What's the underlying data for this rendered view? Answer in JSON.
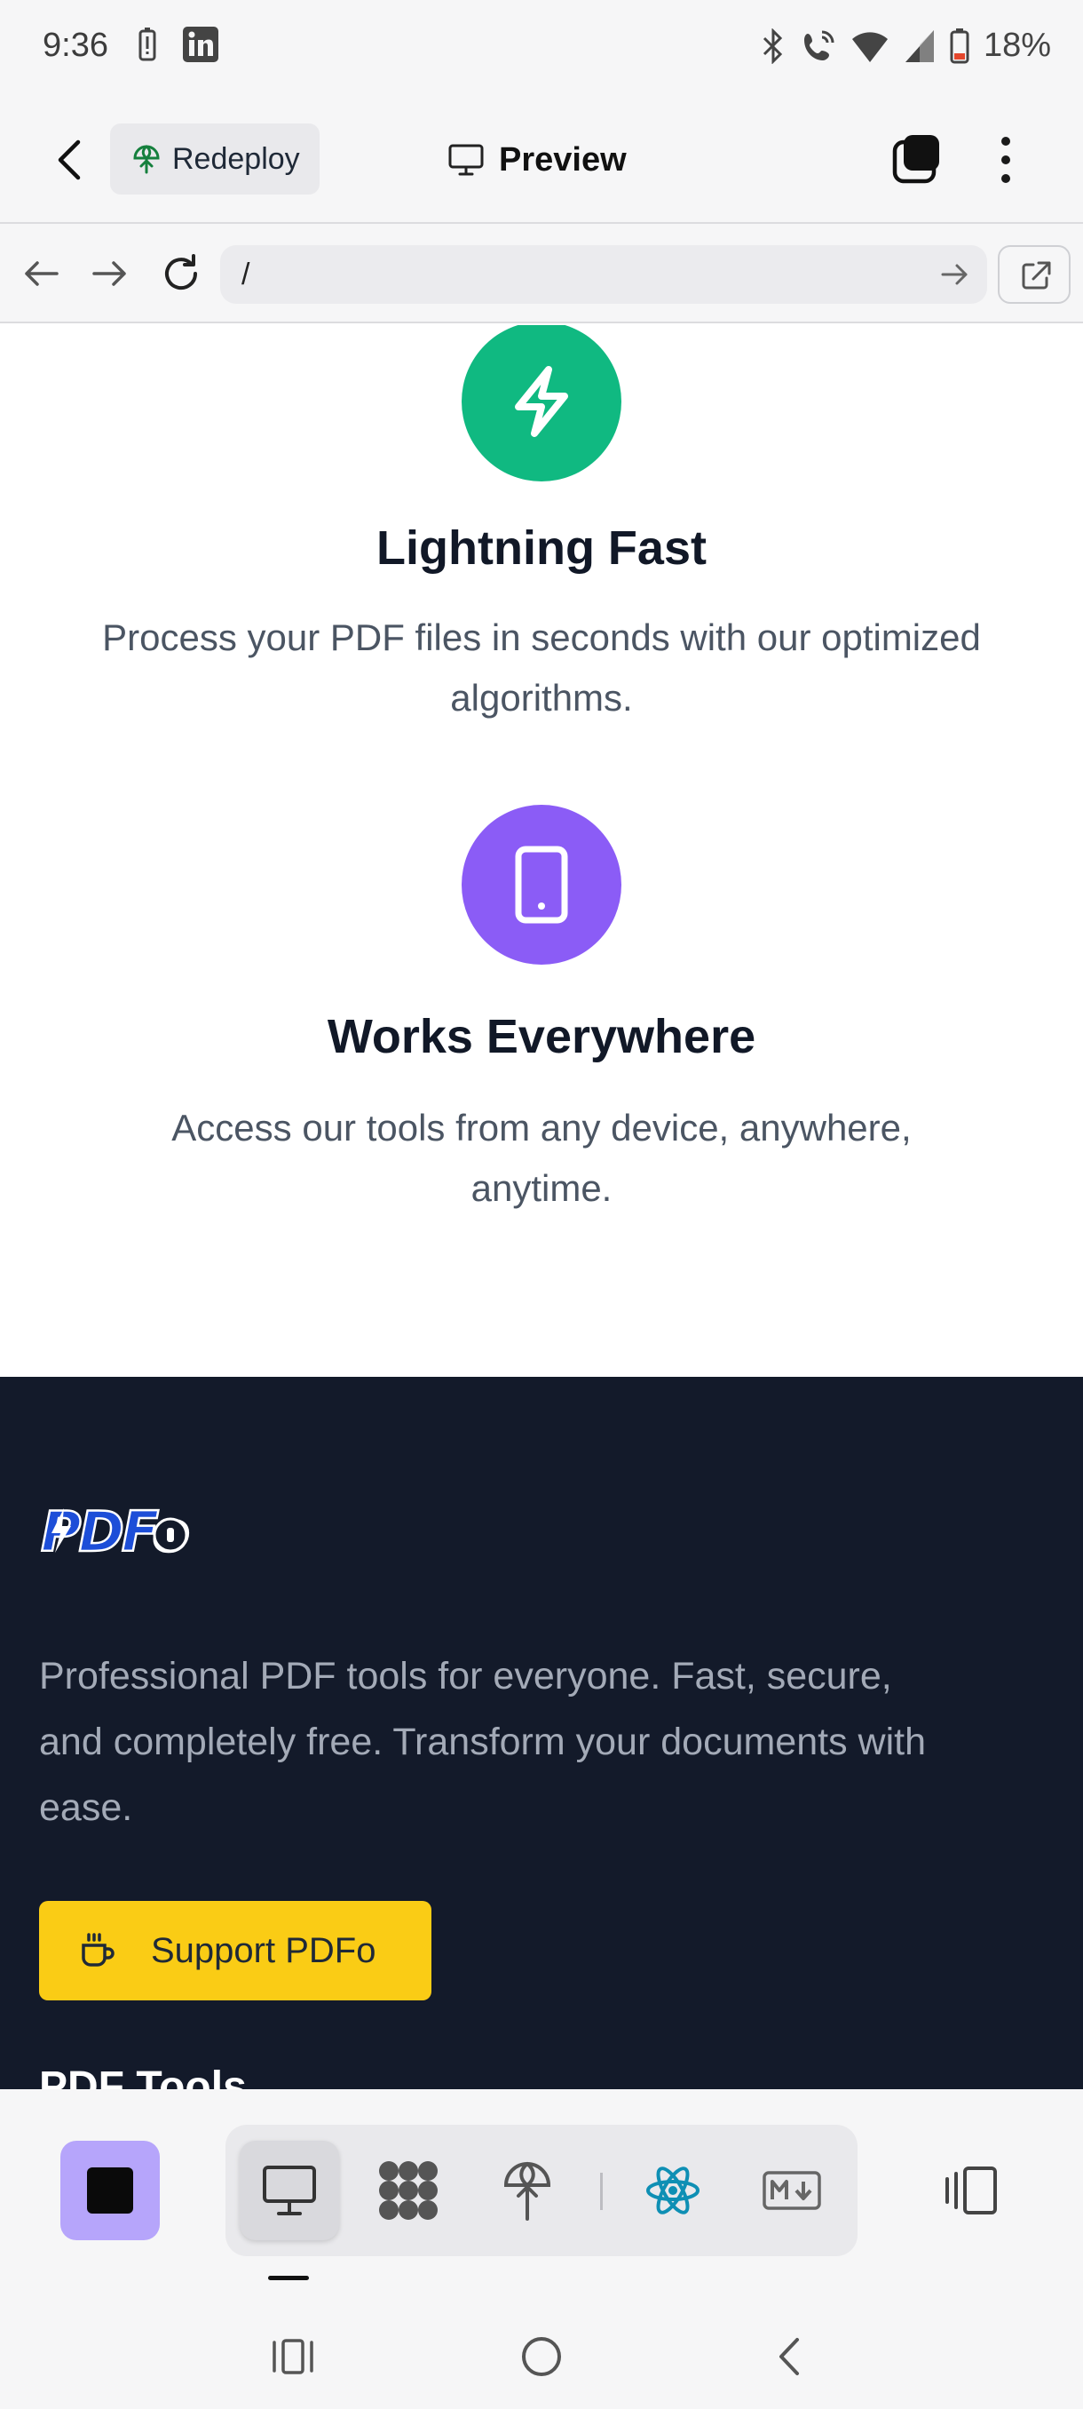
{
  "status_bar": {
    "time": "9:36",
    "battery": "18%",
    "icons": [
      "battery-alert-icon",
      "linkedin-icon",
      "bluetooth-icon",
      "wifi-call-icon",
      "wifi-icon",
      "signal-icon",
      "battery-icon"
    ]
  },
  "app_bar": {
    "redeploy_label": "Redeploy",
    "title": "Preview"
  },
  "browser": {
    "url": "/"
  },
  "features": [
    {
      "icon": "lightning-icon",
      "color": "#10b981",
      "title": "Lightning Fast",
      "desc_line1": "Process your PDF files in seconds with our optimized",
      "desc_line2": "algorithms."
    },
    {
      "icon": "phone-icon",
      "color": "#8b5cf6",
      "title": "Works Everywhere",
      "desc_line1": "Access our tools from any device, anywhere,",
      "desc_line2": "anytime."
    }
  ],
  "footer": {
    "logo_text": "PDFo",
    "desc_line1": "Professional PDF tools for everyone. Fast, secure,",
    "desc_line2": "and completely free. Transform your documents with",
    "desc_line3": "ease.",
    "support_label": "Support PDFo",
    "section_heading": "PDF Tools"
  },
  "toolbar": {
    "active_tool": "preview",
    "tools": [
      "monitor-icon",
      "grid-icon",
      "deploy-icon",
      "react-icon",
      "markdown-icon"
    ]
  },
  "colors": {
    "footer_bg": "#131a2a",
    "support_button": "#facc15",
    "stop_button": "#b6a5fb"
  }
}
